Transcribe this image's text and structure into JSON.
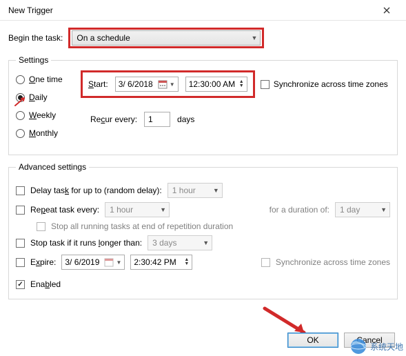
{
  "titlebar": {
    "title": "New Trigger"
  },
  "begin": {
    "label": "Begin the task:",
    "selected": "On a schedule"
  },
  "settings": {
    "legend": "Settings",
    "frequency": {
      "one_time": "One time",
      "daily": "Daily",
      "weekly": "Weekly",
      "monthly": "Monthly",
      "selected": "daily"
    },
    "start": {
      "label": "Start:",
      "date": "3/ 6/2018",
      "time": "12:30:00 AM",
      "sync_label": "Synchronize across time zones",
      "sync_checked": false
    },
    "recur": {
      "label": "Recur every:",
      "value": "1",
      "unit": "days"
    }
  },
  "advanced": {
    "legend": "Advanced settings",
    "delay": {
      "label": "Delay task for up to (random delay):",
      "value": "1 hour",
      "checked": false
    },
    "repeat": {
      "label": "Repeat task every:",
      "value": "1 hour",
      "checked": false,
      "duration_label": "for a duration of:",
      "duration_value": "1 day",
      "stop_label": "Stop all running tasks at end of repetition duration",
      "stop_checked": false
    },
    "stop_long": {
      "label": "Stop task if it runs longer than:",
      "value": "3 days",
      "checked": false
    },
    "expire": {
      "label": "Expire:",
      "date": "3/ 6/2019",
      "time": "2:30:42 PM",
      "checked": false,
      "sync_label": "Synchronize across time zones",
      "sync_checked": false
    },
    "enabled": {
      "label": "Enabled",
      "checked": true
    }
  },
  "buttons": {
    "ok": "OK",
    "cancel": "Cancel"
  },
  "watermark": {
    "text": "系统天地"
  }
}
